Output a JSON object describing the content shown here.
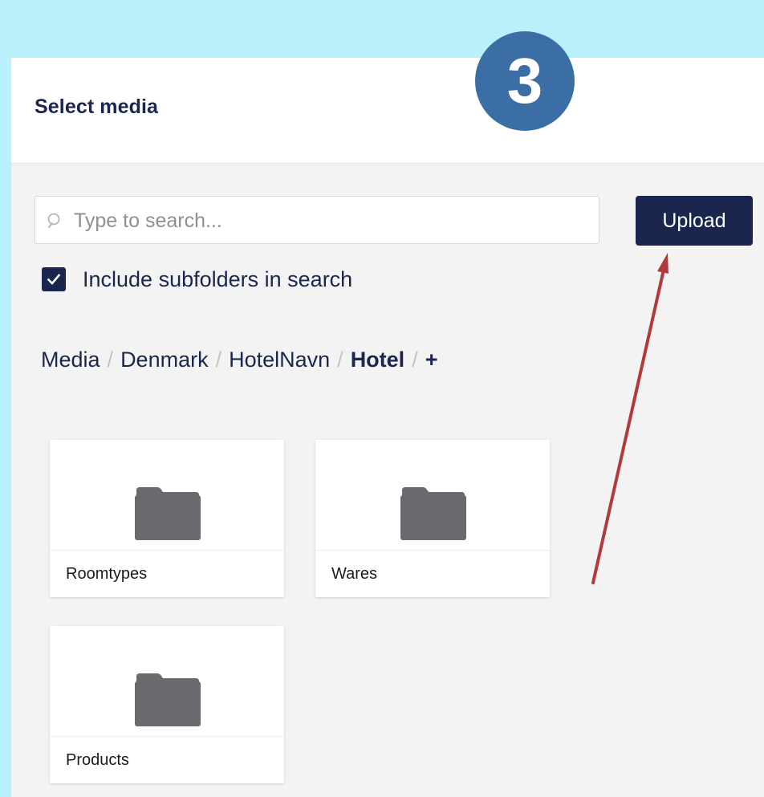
{
  "overlay": {
    "step_number": "3"
  },
  "dialog": {
    "title": "Select media",
    "search": {
      "value": "",
      "placeholder": "Type to search...",
      "icon": "search-icon"
    },
    "upload_label": "Upload",
    "include_subfolders": {
      "label": "Include subfolders in search",
      "checked": true
    },
    "breadcrumb": [
      "Media",
      "Denmark",
      "HotelNavn",
      "Hotel"
    ],
    "breadcrumb_add": "+",
    "folders": [
      {
        "name": "Roomtypes",
        "icon": "folder-icon"
      },
      {
        "name": "Wares",
        "icon": "folder-icon"
      },
      {
        "name": "Products",
        "icon": "folder-icon"
      }
    ]
  },
  "colors": {
    "background": "#b8f1fc",
    "navy": "#1b264f",
    "badge": "#3a6ea5",
    "arrow": "#b33a3a",
    "folder": "#6a6a6e"
  }
}
